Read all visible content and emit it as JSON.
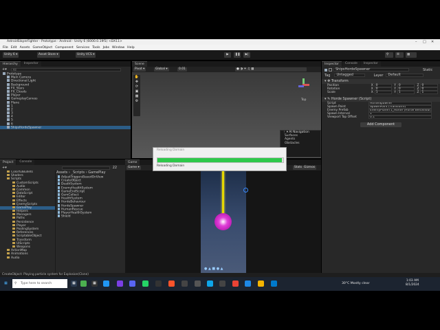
{
  "window": {
    "title": "AstroidSlayerFighter - Prototype - Android - Unity 6 (6000.0.19f1) <DX11>",
    "min_icon": "minimize-icon",
    "max_icon": "maximize-icon",
    "close_icon": "close-icon"
  },
  "menu": [
    "File",
    "Edit",
    "Assets",
    "GameObject",
    "Component",
    "Services",
    "Tools",
    "Jobs",
    "Window",
    "Help"
  ],
  "toolbar": {
    "product": "Unity 6",
    "asset_store": "Asset Store",
    "vcs": "Unity VCS",
    "play_icon": "play-icon",
    "pause_icon": "pause-icon",
    "step_icon": "step-icon"
  },
  "hierarchy": {
    "tabs": [
      "Hierarchy",
      "Inspector"
    ],
    "search_placeholder": "All",
    "items": [
      {
        "label": "Prototype",
        "depth": 0
      },
      {
        "label": "Main Camera",
        "depth": 1
      },
      {
        "label": "Directional Light",
        "depth": 1
      },
      {
        "label": "Background",
        "depth": 1
      },
      {
        "label": "FX_Stars",
        "depth": 1
      },
      {
        "label": "FX_Clouds",
        "depth": 1
      },
      {
        "label": "Player",
        "depth": 1
      },
      {
        "label": "GameplayCanvas",
        "depth": 1
      },
      {
        "label": "Plane",
        "depth": 1
      },
      {
        "label": "1",
        "depth": 1
      },
      {
        "label": "2",
        "depth": 1
      },
      {
        "label": "3",
        "depth": 1
      },
      {
        "label": "4",
        "depth": 1
      },
      {
        "label": "5",
        "depth": 1
      },
      {
        "label": "6",
        "depth": 1
      },
      {
        "label": "ShipsHordeSpawner",
        "depth": 1
      }
    ]
  },
  "project": {
    "tabs": [
      "Project",
      "Console"
    ],
    "folders": [
      "ColorfulBullets",
      "Shaders",
      "Scripts",
      "CustomScripts",
      "Audio",
      "Common",
      "DataScript",
      "Editor",
      "Effects",
      "EnemyScripts",
      "GamePlay",
      "Helpers",
      "Managers",
      "Paths",
      "Persistence",
      "Player",
      "PoolingSystem",
      "References",
      "ScriptableObject",
      "Transform",
      "UIScripts",
      "Weapons",
      "ActionMap",
      "Animations",
      "Audio"
    ],
    "breadcrumb": [
      "Assets",
      "_Scripts",
      "GamePlay"
    ],
    "count": "22",
    "files": [
      "AdjustTriggersBasedOnView",
      "CreateObject",
      "DeathSystem",
      "EnemyHealthSystem",
      "GameEndScript",
      "GemCollect",
      "HealthSystem",
      "HordeBehaviour",
      "HordeSpawner",
      "HumanRescue",
      "PlayerHealthSystem",
      "Shield"
    ]
  },
  "scene": {
    "tab": "Scene",
    "pivot": "Pivot",
    "global": "Global",
    "snap": "0.01",
    "persp": "Top",
    "ai_nav": {
      "title": "AI Navigation",
      "items": [
        "Surfaces",
        "Agents",
        "Obstacles"
      ]
    }
  },
  "dialog": {
    "title": "Reloading Domain",
    "status": "Reloading Domain",
    "progress": 0.99
  },
  "game": {
    "tab": "Game",
    "display": "Game",
    "stats": "Stats",
    "gizmos": "Gizmos"
  },
  "inspector": {
    "tabs": [
      "Inspector",
      "Console",
      "Inspector"
    ],
    "object_name": "ShipsHordeSpawner",
    "static": "Static",
    "tag_label": "Tag",
    "tag_value": "Untagged",
    "layer_label": "Layer",
    "layer_value": "Default",
    "transform": {
      "title": "Transform",
      "rows": [
        {
          "label": "Position",
          "x": "0",
          "y": "0",
          "z": "0"
        },
        {
          "label": "Rotation",
          "x": "0",
          "y": "0",
          "z": "0"
        },
        {
          "label": "Scale",
          "x": "1",
          "y": "1",
          "z": "1"
        }
      ]
    },
    "horde": {
      "title": "Horde Spawner (Script)",
      "rows": [
        {
          "label": "Script",
          "value": "HordeSpawner"
        },
        {
          "label": "Spawn Point",
          "value": "SpawnPoint (Transform)"
        },
        {
          "label": "Enemy Prefab",
          "value": "EnemyPlaneT1_Horde (Horde Behaviour)"
        },
        {
          "label": "Spawn Interval",
          "value": "1"
        },
        {
          "label": "Viewport Top Offset",
          "value": "0.1"
        }
      ]
    },
    "add_component": "Add Component"
  },
  "status": {
    "message": "CreateObject: Playing particle system for Explosion(Clone)"
  },
  "taskbar": {
    "search_placeholder": "Type here to search",
    "weather": "30°C  Mostly clear",
    "time": "1:03 AM",
    "date": "8/1/2024"
  },
  "colors": {
    "progress": "#2ec84a",
    "accent_yellow": "#e6d800",
    "magenta": "#d830d0"
  }
}
